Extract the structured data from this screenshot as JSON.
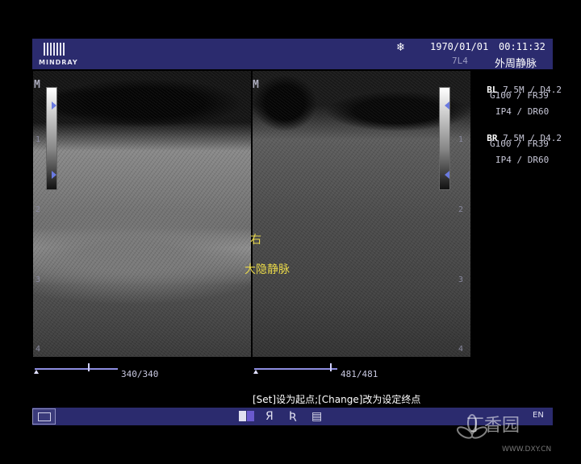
{
  "header": {
    "logo": "MINDRAY",
    "freeze_icon": "snowflake-icon",
    "date": "1970/01/01",
    "time": "00:11:32",
    "probe": "7L4",
    "preset": "外周静脉"
  },
  "params": {
    "left": {
      "tag": "BL",
      "line1": "7.5M / D4.2",
      "line2": "G100 / FR39",
      "line3": "IP4 / DR60"
    },
    "right": {
      "tag": "BR",
      "line1": "7.5M / D4.2",
      "line2": "G100 / FR39",
      "line3": "IP4 / DR60"
    }
  },
  "image": {
    "marker": "M",
    "depth_ticks": [
      "1",
      "2",
      "3",
      "4"
    ],
    "annotations": {
      "side": "右",
      "vessel": "大隐静脉"
    }
  },
  "cine": {
    "left": {
      "label": "340/340",
      "progress": 1.0
    },
    "right": {
      "label": "481/481",
      "progress": 1.0
    }
  },
  "hint": "[Set]设为起点;[Change]改为设定终点",
  "footer": {
    "icons": [
      "menu-icon",
      "dual-color-icon",
      "ya-icon",
      "reverse-icon",
      "report-icon"
    ],
    "glyph_ya": "Я",
    "glyph_re": "Ʀ",
    "glyph_report": "▤",
    "lang": "EN"
  },
  "watermark": {
    "text": "丁香园",
    "url": "WWW.DXY.CN"
  }
}
